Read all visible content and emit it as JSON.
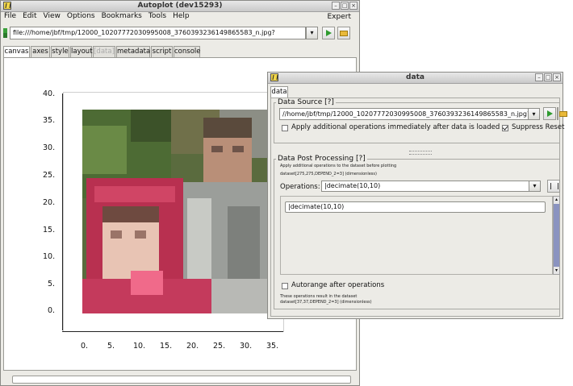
{
  "main_window": {
    "title": "Autoplot (dev15293)",
    "menu": [
      "File",
      "Edit",
      "View",
      "Options",
      "Bookmarks",
      "Tools",
      "Help"
    ],
    "expert_label": "Expert",
    "url": "file:///home/jbf/tmp/12000_102077720309950​08_3760393236149865583_n.jpg?",
    "tabs": [
      {
        "label": "canvas",
        "selected": true
      },
      {
        "label": "axes"
      },
      {
        "label": "style"
      },
      {
        "label": "layout"
      },
      {
        "label": "[data]",
        "disabled": true
      },
      {
        "label": "metadata"
      },
      {
        "label": "script"
      },
      {
        "label": "console"
      }
    ]
  },
  "plot": {
    "y_ticks": [
      "40.",
      "35.",
      "30.",
      "25.",
      "20.",
      "15.",
      "10.",
      "5.",
      "0."
    ],
    "x_ticks": [
      "0.",
      "5.",
      "10.",
      "15.",
      "20.",
      "25.",
      "30.",
      "35."
    ]
  },
  "data_dialog": {
    "title": "data",
    "tab": "data",
    "source_legend": "Data Source [?]",
    "source_url": "//home/jbf/tmp/12000_102077720309950​08_3760393236149865583_n.jpg?",
    "apply_label": "Apply additional operations immediately after data is loaded",
    "suppress_reset_label": "Suppress Reset",
    "post_legend": "Data Post Processing [?]",
    "post_desc": "Apply additional operations to the dataset before plotting",
    "dataset_in": "dataset[275,275,DEPEND_2=3] (dimensionless)",
    "operations_label": "Operations:",
    "operations_value": "|decimate(10,10)",
    "op_item": "|decimate(10,10)",
    "autorange_label": "Autorange after operations",
    "result_desc": "These operations result in the dataset",
    "dataset_out": "dataset[37,37,DEPEND_2=3] (dimensionless)"
  },
  "colors": {
    "accent_green": "#2e9a2e",
    "folder": "#e9b93a",
    "scroll_thumb": "#8a93c0"
  }
}
